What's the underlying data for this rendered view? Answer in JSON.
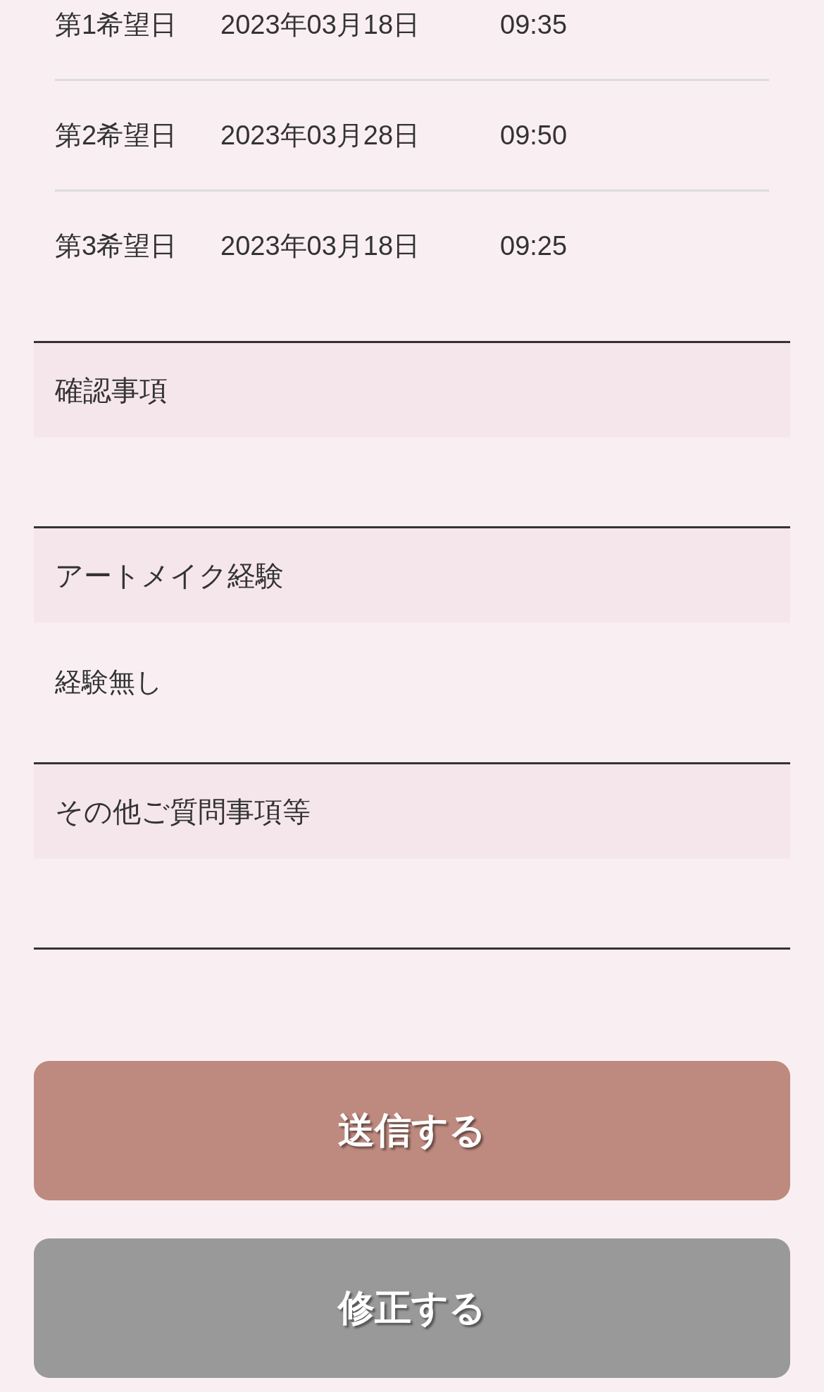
{
  "preferred_dates": [
    {
      "label": "第1希望日",
      "date": "2023年03月18日",
      "time": "09:35"
    },
    {
      "label": "第2希望日",
      "date": "2023年03月28日",
      "time": "09:50"
    },
    {
      "label": "第3希望日",
      "date": "2023年03月18日",
      "time": "09:25"
    }
  ],
  "sections": [
    {
      "heading": "確認事項"
    },
    {
      "heading": "アートメイク経験",
      "value": "経験無し"
    },
    {
      "heading": "その他ご質問事項等"
    }
  ],
  "buttons": [
    {
      "label": "送信する",
      "kind": "primary"
    },
    {
      "label": "修正する",
      "kind": "secondary"
    }
  ]
}
